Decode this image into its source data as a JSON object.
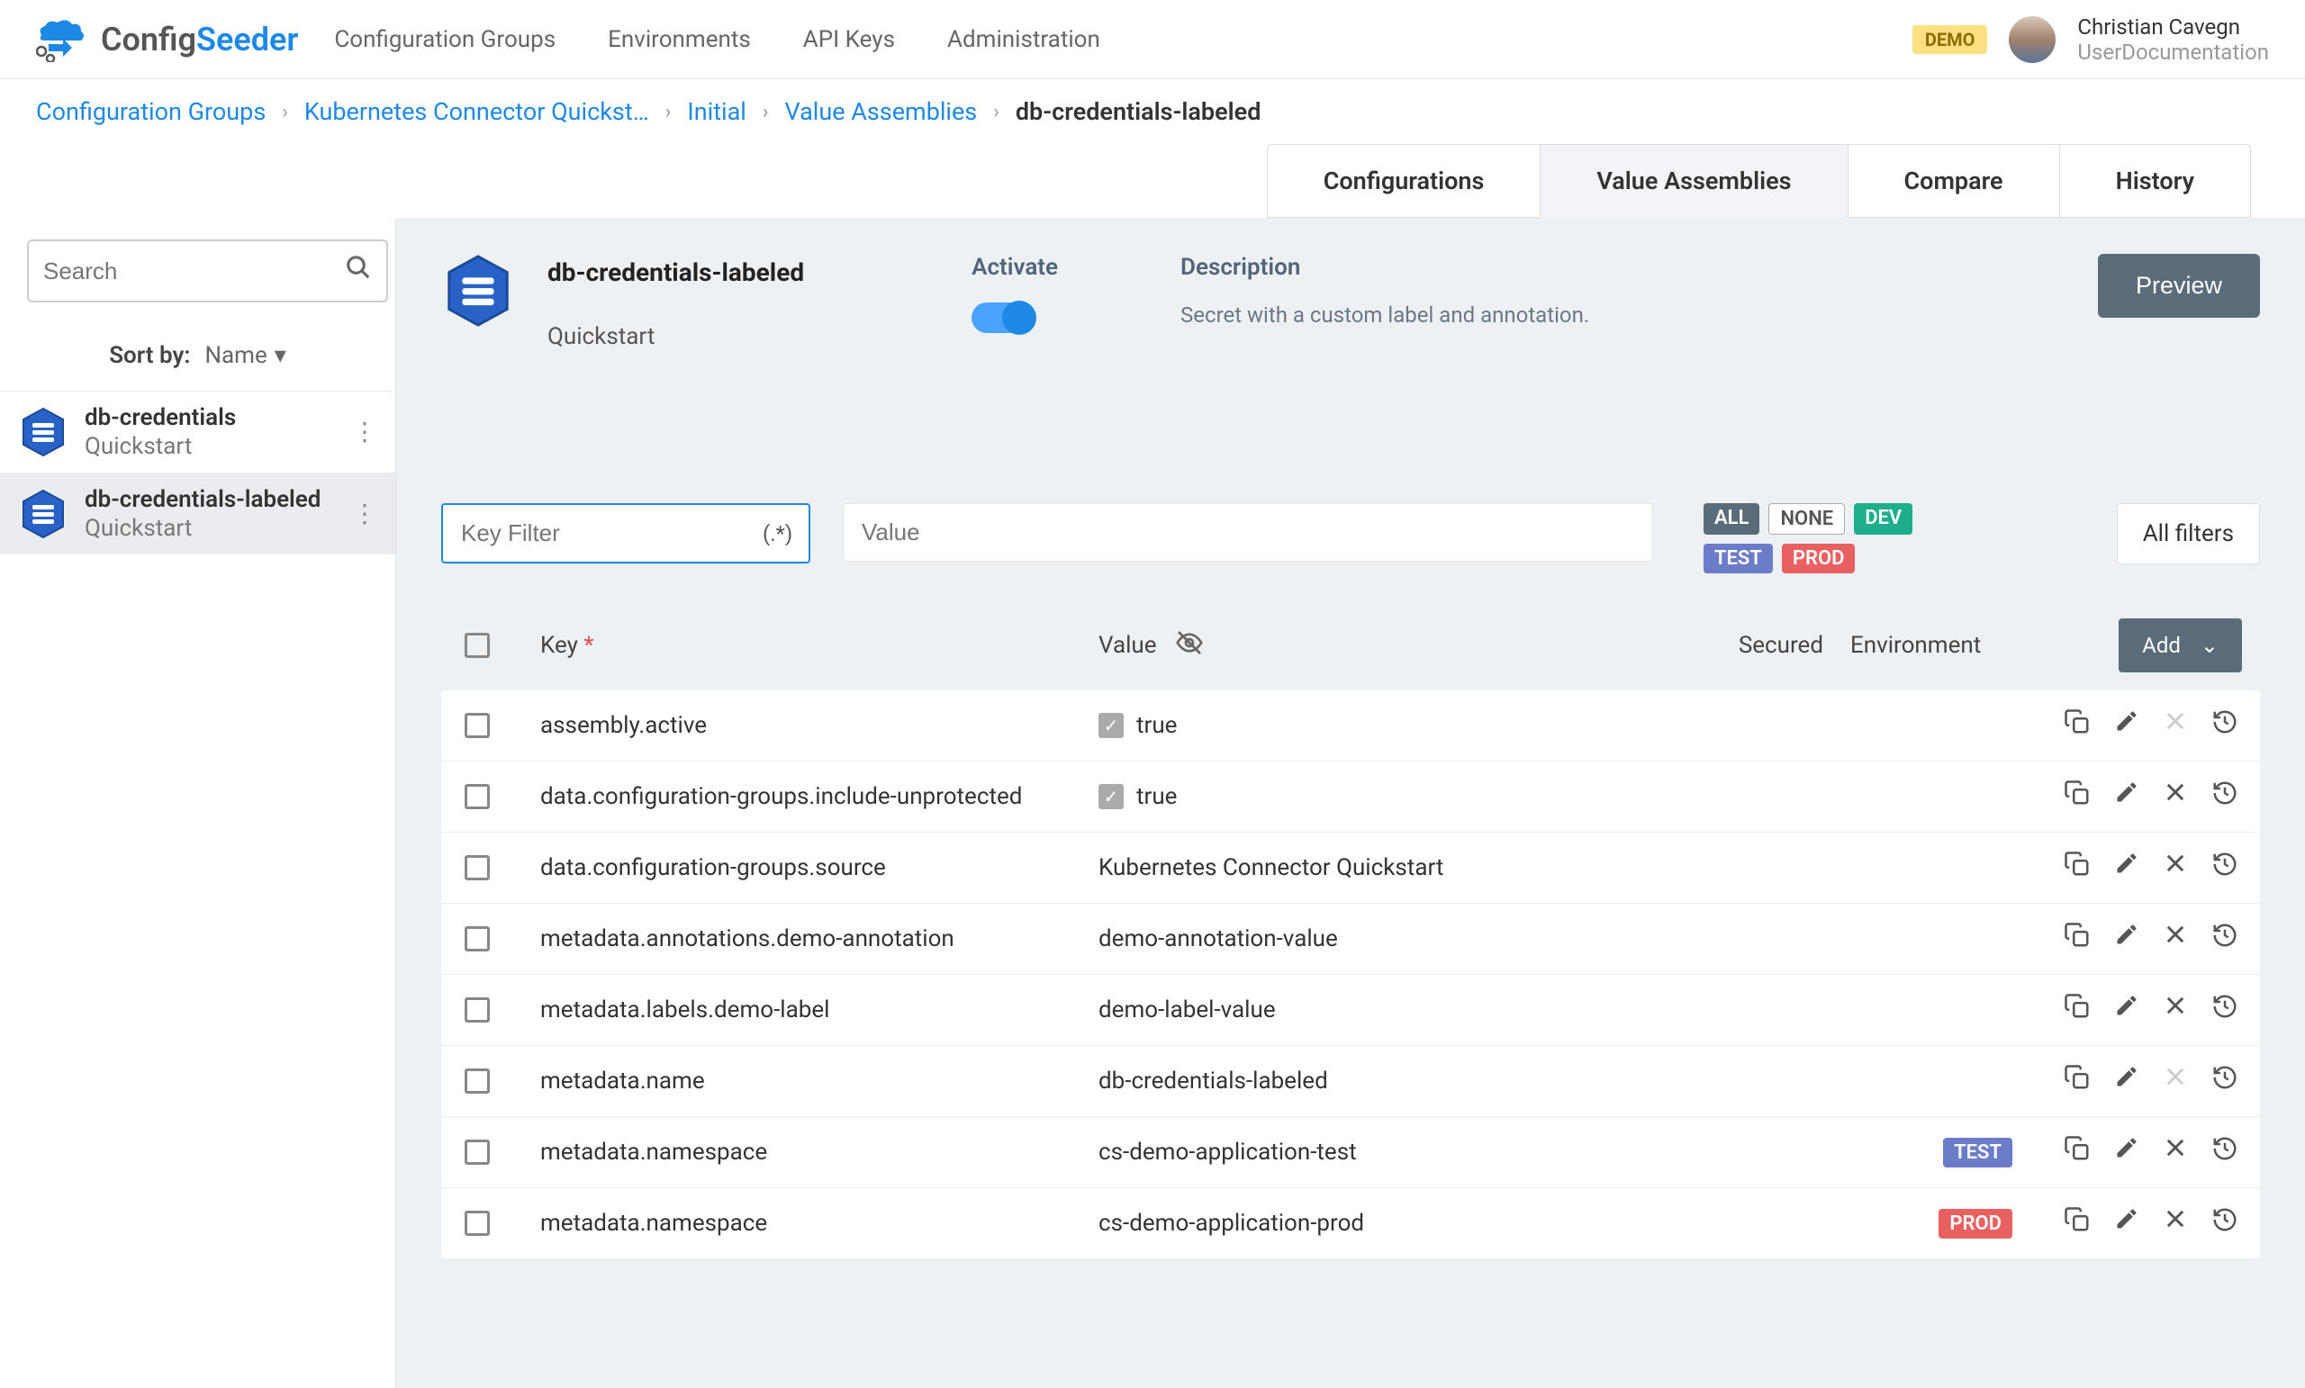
{
  "brand": {
    "prefix": "Config",
    "suffix": "Seeder"
  },
  "nav": {
    "groups": "Configuration Groups",
    "environments": "Environments",
    "apikeys": "API Keys",
    "admin": "Administration"
  },
  "demo_badge": "DEMO",
  "user": {
    "name": "Christian Cavegn",
    "sub": "UserDocumentation"
  },
  "breadcrumbs": {
    "b0": "Configuration Groups",
    "b1": "Kubernetes Connector Quickst…",
    "b2": "Initial",
    "b3": "Value Assemblies",
    "current": "db-credentials-labeled"
  },
  "tabs": {
    "config": "Configurations",
    "vas": "Value Assemblies",
    "compare": "Compare",
    "history": "History"
  },
  "sidebar": {
    "search_placeholder": "Search",
    "sort_label": "Sort by:",
    "sort_value": "Name",
    "items": [
      {
        "title": "db-credentials",
        "sub": "Quickstart"
      },
      {
        "title": "db-credentials-labeled",
        "sub": "Quickstart"
      }
    ]
  },
  "assembly": {
    "title": "db-credentials-labeled",
    "sub": "Quickstart",
    "activate_label": "Activate",
    "desc_label": "Description",
    "desc_text": "Secret with a custom label and annotation.",
    "preview": "Preview"
  },
  "filters": {
    "key_placeholder": "Key Filter",
    "regex": "(.*)",
    "value_placeholder": "Value",
    "tags": {
      "all": "ALL",
      "none": "NONE",
      "dev": "DEV",
      "test": "TEST",
      "prod": "PROD"
    },
    "allfilters": "All filters"
  },
  "table": {
    "headers": {
      "key": "Key",
      "value": "Value",
      "secured": "Secured",
      "env": "Environment",
      "add": "Add"
    },
    "rows": [
      {
        "key": "assembly.active",
        "value": "true",
        "bool": true,
        "env": "",
        "del_disabled": true
      },
      {
        "key": "data.configuration-groups.include-unprotected",
        "value": "true",
        "bool": true,
        "env": "",
        "del_disabled": false
      },
      {
        "key": "data.configuration-groups.source",
        "value": "Kubernetes Connector Quickstart",
        "bool": false,
        "env": "",
        "del_disabled": false
      },
      {
        "key": "metadata.annotations.demo-annotation",
        "value": "demo-annotation-value",
        "bool": false,
        "env": "",
        "del_disabled": false
      },
      {
        "key": "metadata.labels.demo-label",
        "value": "demo-label-value",
        "bool": false,
        "env": "",
        "del_disabled": false
      },
      {
        "key": "metadata.name",
        "value": "db-credentials-labeled",
        "bool": false,
        "env": "",
        "del_disabled": true
      },
      {
        "key": "metadata.namespace",
        "value": "cs-demo-application-test",
        "bool": false,
        "env": "TEST",
        "del_disabled": false
      },
      {
        "key": "metadata.namespace",
        "value": "cs-demo-application-prod",
        "bool": false,
        "env": "PROD",
        "del_disabled": false
      }
    ]
  }
}
